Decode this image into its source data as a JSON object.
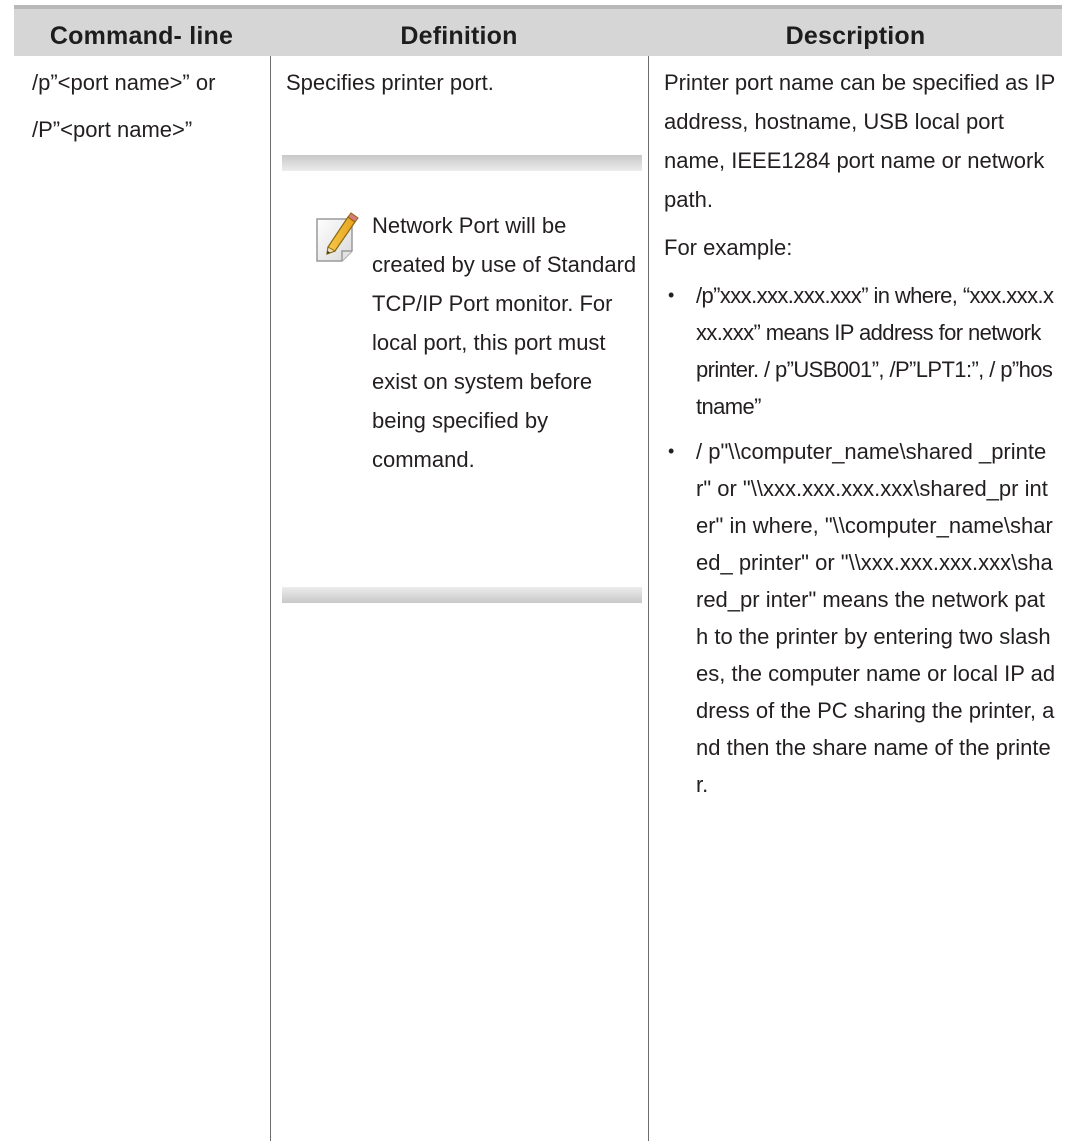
{
  "table": {
    "headers": [
      "Command- line",
      "Definition",
      "Description"
    ],
    "row": {
      "command_line": {
        "line1": "/p”<port name>” or",
        "line2": "/P”<port name>”"
      },
      "definition": {
        "text": "Specifies printer port.",
        "note_icon": "note-pencil-icon",
        "note_text": "Network Port will be created by use of Standard TCP/IP Port monitor. For local port, this port must exist on system before being specified by command."
      },
      "description": {
        "paragraph1": "Printer port name can be specified as IP address, hostname, USB local port name, IEEE1284 port name or network path.",
        "paragraph2": "For example:",
        "bullets": [
          "/p”xxx.xxx.xxx.xxx” in where, “xxx.xxx.xxx.xxx” means IP address for network printer. / p”USB001”, /P”LPT1:”, / p”hostname”",
          "/ p\"\\\\computer_name\\shared _printer\" or \"\\\\xxx.xxx.xxx.xxx\\shared_pr inter\" in where, \"\\\\computer_name\\shared_ printer\" or \"\\\\xxx.xxx.xxx.xxx\\shared_pr inter\" means the network path to the printer by entering two slashes, the computer name or local IP address of the PC sharing the printer, and then the share name of the printer."
        ],
        "bullet_symbol": "•"
      }
    }
  },
  "colors": {
    "header_bg": "#d6d6d6",
    "header_border": "#b9b9b9",
    "rule": "#6d6d6d",
    "text": "#231f20"
  }
}
